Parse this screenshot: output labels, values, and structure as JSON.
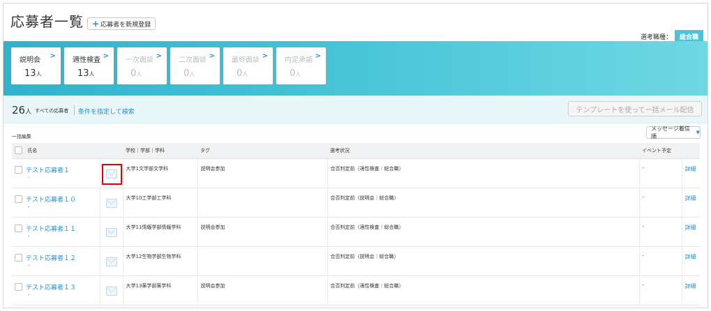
{
  "header": {
    "title": "応募者一覧",
    "new_button_label": "応募者を新規登録",
    "job_type_label": "選考職種：",
    "job_type_value": "総合職"
  },
  "steps": [
    {
      "name": "説明会",
      "count": "13",
      "unit": "人",
      "enabled": true
    },
    {
      "name": "適性検査",
      "count": "13",
      "unit": "人",
      "enabled": true
    },
    {
      "name": "一次面談",
      "count": "0",
      "unit": "人",
      "enabled": false
    },
    {
      "name": "二次面談",
      "count": "0",
      "unit": "人",
      "enabled": false
    },
    {
      "name": "最終面談",
      "count": "0",
      "unit": "人",
      "enabled": false
    },
    {
      "name": "内定承諾",
      "count": "0",
      "unit": "人",
      "enabled": false
    }
  ],
  "filter": {
    "total": "26",
    "unit": "人",
    "total_label": "すべての応募者",
    "search_link": "条件を指定して検索",
    "mail_all_button": "テンプレートを使って一括メール配信"
  },
  "table": {
    "bulk_edit_label": "一括編集",
    "sort_label": "メッセージ着信順",
    "columns": [
      "氏名",
      "",
      "学校｜学部｜学科",
      "タグ",
      "選考状況",
      "イベント予定",
      ""
    ],
    "detail_label": "詳細",
    "rows": [
      {
        "name": "テスト応募者１",
        "sub": "-",
        "school": "大学1文学部文学科",
        "tag": "説明会参加",
        "status": "合否判定前（適性検査｜総合職）",
        "event": "-"
      },
      {
        "name": "テスト応募者１０",
        "sub": "-",
        "school": "大学10工学部工学科",
        "tag": "",
        "status": "合否判定前（説明会｜総合職）",
        "event": "-"
      },
      {
        "name": "テスト応募者１１",
        "sub": "-",
        "school": "大学11情報学部情報学科",
        "tag": "説明会参加",
        "status": "合否判定前（適性検査｜総合職）",
        "event": "-"
      },
      {
        "name": "テスト応募者１２",
        "sub": "-",
        "school": "大学12生物学部生物学科",
        "tag": "",
        "status": "合否判定前（説明会｜総合職）",
        "event": "-"
      },
      {
        "name": "テスト応募者１３",
        "sub": "-",
        "school": "大学13薬学部薬学科",
        "tag": "説明会参加",
        "status": "合否判定前（適性検査｜総合職）",
        "event": "-"
      }
    ]
  },
  "colors": {
    "accent": "#2a8fc8",
    "banner": "#45c3d6",
    "highlight": "#e00000"
  }
}
